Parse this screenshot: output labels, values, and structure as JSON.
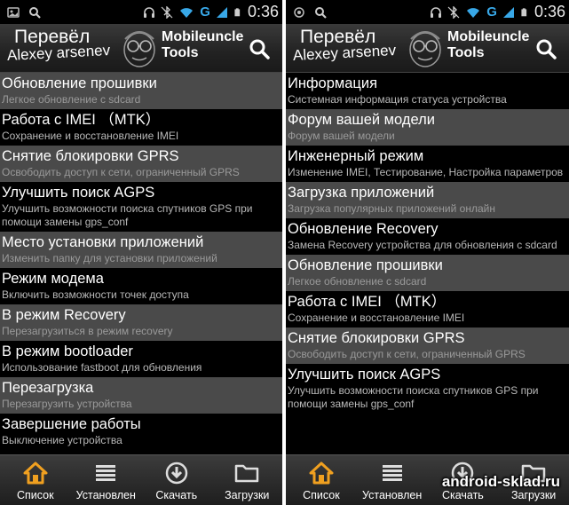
{
  "status": {
    "g_label": "G",
    "time": "0:36"
  },
  "header": {
    "logo_line1": "Перевёл",
    "logo_line2": "Alexey arsenev",
    "app_title_line1": "Mobileuncle",
    "app_title_line2": "Tools"
  },
  "left_list": [
    {
      "title": "Обновление прошивки",
      "subtitle": "Легкое обновление с sdcard",
      "alt": true
    },
    {
      "title": "Работа с IMEI （MTK）",
      "subtitle": "Сохранение и восстановление IMEI",
      "alt": false
    },
    {
      "title": "Снятие блокировки GPRS",
      "subtitle": "Освободить доступ к сети, ограниченный GPRS",
      "alt": true
    },
    {
      "title": "Улучшить поиск AGPS",
      "subtitle": "Улучшить возможности поиска спутников GPS при помощи замены gps_conf",
      "alt": false
    },
    {
      "title": "Место установки приложений",
      "subtitle": "Изменить папку для установки приложений",
      "alt": true
    },
    {
      "title": "Режим модема",
      "subtitle": "Включить возможности точек доступа",
      "alt": false
    },
    {
      "title": "В режим Recovery",
      "subtitle": "Перезагрузиться в режим recovery",
      "alt": true
    },
    {
      "title": "В режим bootloader",
      "subtitle": "Использование fastboot для обновления",
      "alt": false
    },
    {
      "title": "Перезагрузка",
      "subtitle": "Перезагрузить устройства",
      "alt": true
    },
    {
      "title": "Завершение работы",
      "subtitle": "Выключение устройства",
      "alt": false
    }
  ],
  "right_list": [
    {
      "title": "Информация",
      "subtitle": "Системная информация статуса устройства",
      "alt": false
    },
    {
      "title": "Форум вашей модели",
      "subtitle": "Форум вашей модели",
      "alt": true
    },
    {
      "title": "Инженерный режим",
      "subtitle": "Изменение IMEI, Тестирование, Настройка параметров",
      "alt": false
    },
    {
      "title": "Загрузка приложений",
      "subtitle": "Загрузка популярных приложений онлайн",
      "alt": true
    },
    {
      "title": "Обновление Recovery",
      "subtitle": "Замена Recovery устройства для обновления с sdcard",
      "alt": false
    },
    {
      "title": "Обновление прошивки",
      "subtitle": "Легкое обновление с sdcard",
      "alt": true
    },
    {
      "title": "Работа с IMEI （MTK）",
      "subtitle": "Сохранение и восстановление IMEI",
      "alt": false
    },
    {
      "title": "Снятие блокировки GPRS",
      "subtitle": "Освободить доступ к сети, ограниченный GPRS",
      "alt": true
    },
    {
      "title": "Улучшить поиск AGPS",
      "subtitle": "Улучшить возможности поиска спутников GPS при помощи замены gps_conf",
      "alt": false
    }
  ],
  "tabs": [
    {
      "label": "Список",
      "icon": "home-icon"
    },
    {
      "label": "Установлен",
      "icon": "list-icon"
    },
    {
      "label": "Скачать",
      "icon": "download-icon"
    },
    {
      "label": "Загрузки",
      "icon": "folder-icon"
    }
  ],
  "watermark": "android-sklad.ru",
  "colors": {
    "home_icon": "#f0a020",
    "alt_row": "#4a4a4a",
    "signal_blue": "#38a8e8"
  }
}
